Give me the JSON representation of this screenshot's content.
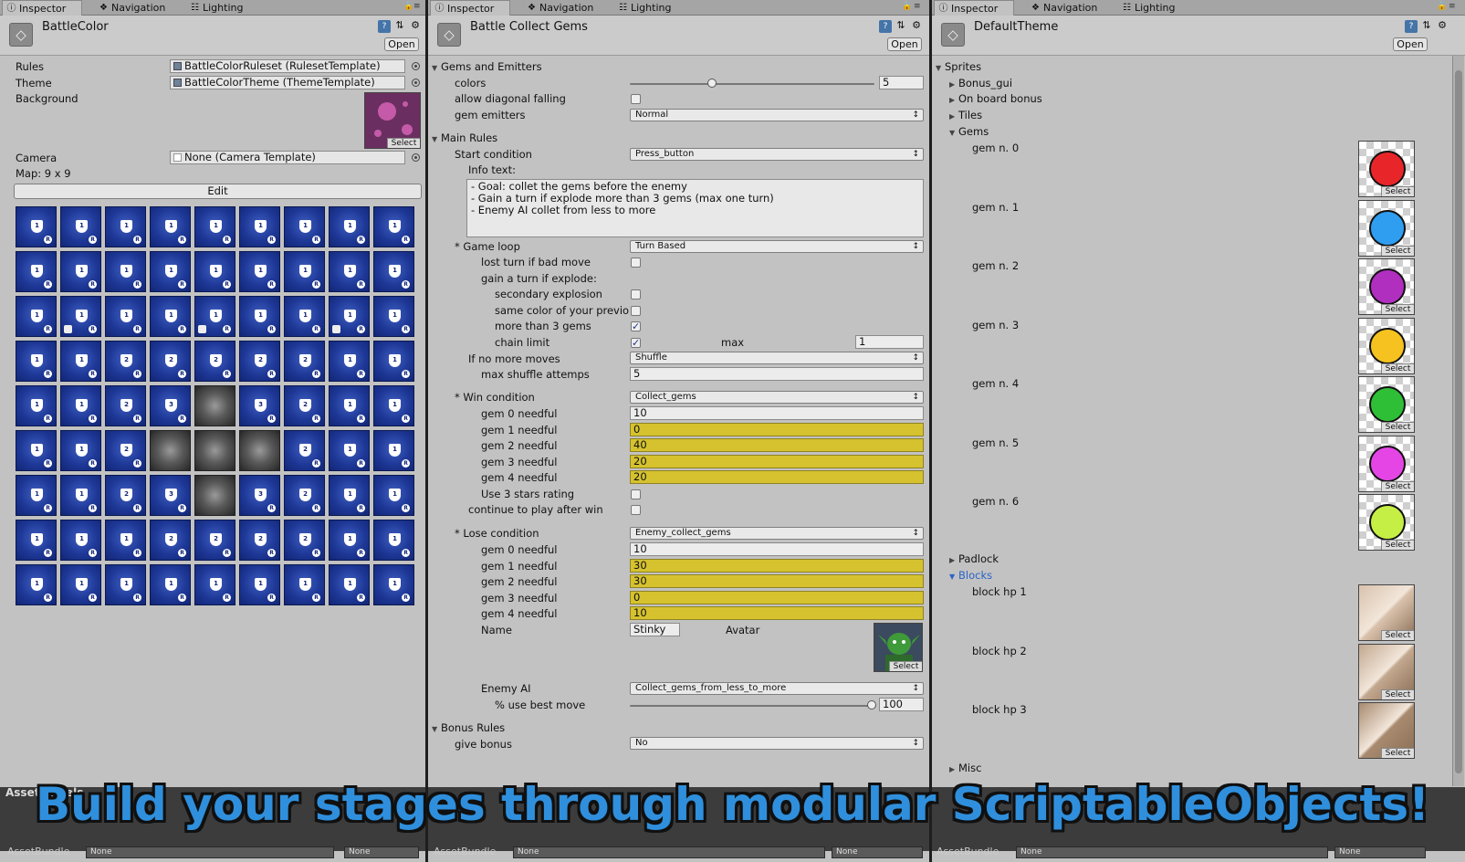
{
  "tabs": {
    "inspector": "Inspector",
    "navigation": "Navigation",
    "lighting": "Lighting"
  },
  "header_open": "Open",
  "select_label": "Select",
  "left": {
    "title": "BattleColor",
    "rules_label": "Rules",
    "rules_value": "BattleColorRuleset (RulesetTemplate)",
    "theme_label": "Theme",
    "theme_value": "BattleColorTheme (ThemeTemplate)",
    "background_label": "Background",
    "camera_label": "Camera",
    "camera_value": "None (Camera Template)",
    "map_label": "Map: 9 x 9",
    "edit_button": "Edit",
    "map": [
      [
        "b1",
        "b1",
        "b1",
        "b1",
        "b1",
        "b1",
        "b1",
        "b1",
        "b1"
      ],
      [
        "b1",
        "b1",
        "b1",
        "b1",
        "b1",
        "b1",
        "b1",
        "b1",
        "b1"
      ],
      [
        "b1",
        "b1L",
        "b1",
        "b1",
        "b1L",
        "b1",
        "b1",
        "b1L",
        "b1"
      ],
      [
        "b1",
        "b1",
        "b2",
        "b2",
        "b2",
        "b2",
        "b2",
        "b1",
        "b1"
      ],
      [
        "b1",
        "b1",
        "b2",
        "b3",
        "e",
        "b3",
        "b2",
        "b1",
        "b1"
      ],
      [
        "b1",
        "b1",
        "b2",
        "e",
        "e",
        "e",
        "b2",
        "b1",
        "b1"
      ],
      [
        "b1",
        "b1",
        "b2",
        "b3",
        "e",
        "b3",
        "b2",
        "b1",
        "b1"
      ],
      [
        "b1",
        "b1",
        "b1",
        "b2",
        "b2",
        "b2",
        "b2",
        "b1",
        "b1"
      ],
      [
        "b1",
        "b1",
        "b1",
        "b1",
        "b1",
        "b1",
        "b1",
        "b1",
        "b1"
      ]
    ]
  },
  "middle": {
    "title": "Battle Collect Gems",
    "gems_section": "Gems and Emitters",
    "colors_label": "colors",
    "colors_value": "5",
    "diagonal_label": "allow diagonal falling",
    "emitters_label": "gem emitters",
    "emitters_value": "Normal",
    "main_section": "Main Rules",
    "start_label": "Start condition",
    "start_value": "Press_button",
    "info_label": "Info text:",
    "info_text": "- Goal: collet the gems before the enemy\n- Gain a turn if explode more than 3 gems (max one turn)\n- Enemy AI collet from less to more",
    "loop_label": "* Game loop",
    "loop_value": "Turn Based",
    "lost_turn_label": "lost turn if bad move",
    "gain_turn_label": "gain a turn if explode:",
    "secondary_label": "secondary explosion",
    "same_color_label": "same color of your previous",
    "more3_label": "more than 3 gems",
    "chain_label": "chain limit",
    "max_label": "max",
    "max_value": "1",
    "no_moves_label": "If no more moves",
    "no_moves_value": "Shuffle",
    "shuffle_label": "max shuffle attemps",
    "shuffle_value": "5",
    "win_label": "* Win condition",
    "win_value": "Collect_gems",
    "win_needful": [
      {
        "label": "gem 0 needful",
        "value": "10"
      },
      {
        "label": "gem 1 needful",
        "value": "0"
      },
      {
        "label": "gem 2 needful",
        "value": "40"
      },
      {
        "label": "gem 3 needful",
        "value": "20"
      },
      {
        "label": "gem 4 needful",
        "value": "20"
      }
    ],
    "stars_label": "Use 3 stars rating",
    "continue_label": "continue to play after win",
    "lose_label": "* Lose condition",
    "lose_value": "Enemy_collect_gems",
    "lose_needful": [
      {
        "label": "gem 0 needful",
        "value": "10"
      },
      {
        "label": "gem 1 needful",
        "value": "30"
      },
      {
        "label": "gem 2 needful",
        "value": "30"
      },
      {
        "label": "gem 3 needful",
        "value": "0"
      },
      {
        "label": "gem 4 needful",
        "value": "10"
      }
    ],
    "name_label": "Name",
    "name_value": "Stinky",
    "avatar_label": "Avatar",
    "enemy_ai_label": "Enemy AI",
    "enemy_ai_value": "Collect_gems_from_less_to_more",
    "best_move_label": "% use best move",
    "best_move_value": "100",
    "bonus_section": "Bonus Rules",
    "give_bonus_label": "give bonus",
    "give_bonus_value": "No"
  },
  "right": {
    "title": "DefaultTheme",
    "sprites": "Sprites",
    "bonus_gui": "Bonus_gui",
    "on_board_bonus": "On board bonus",
    "tiles": "Tiles",
    "gems": "Gems",
    "gem_list": [
      {
        "label": "gem n. 0",
        "color": "#e8262a"
      },
      {
        "label": "gem n. 1",
        "color": "#2f9ef0"
      },
      {
        "label": "gem n. 2",
        "color": "#b02fbf"
      },
      {
        "label": "gem n. 3",
        "color": "#f5c21f"
      },
      {
        "label": "gem n. 4",
        "color": "#2fbf36"
      },
      {
        "label": "gem n. 5",
        "color": "#e545e5"
      },
      {
        "label": "gem n. 6",
        "color": "#c6ef45"
      }
    ],
    "padlock": "Padlock",
    "blocks": "Blocks",
    "block_list": [
      {
        "label": "block hp 1",
        "color": "#d9c2ad"
      },
      {
        "label": "block hp 2",
        "color": "#c2a88f"
      },
      {
        "label": "block hp 3",
        "color": "#a88a6f"
      }
    ],
    "misc": "Misc"
  },
  "footer": {
    "asset_label": "Asset Labels",
    "asset_bundle": "AssetBundle",
    "none": "None"
  },
  "banner": "Build your stages through modular ScriptableObjects!",
  "colors": {
    "needful_yellow": "#d5c22e",
    "banner_blue": "#2f8fdc",
    "map_blue": "#1e3897"
  }
}
